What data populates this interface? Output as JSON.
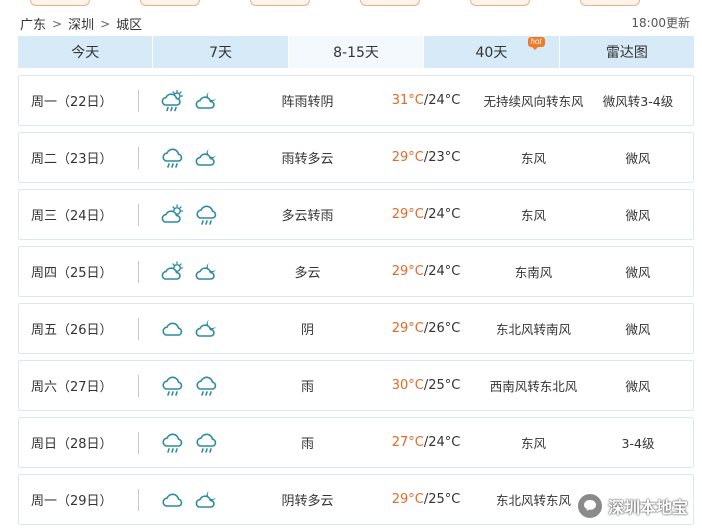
{
  "breadcrumb": {
    "province": "广东",
    "city": "深圳",
    "district": "城区"
  },
  "update_time": "18:00更新",
  "tabs": [
    {
      "label": "今天"
    },
    {
      "label": "7天"
    },
    {
      "label": "8-15天"
    },
    {
      "label": "40天",
      "badge": "hot"
    },
    {
      "label": "雷达图"
    }
  ],
  "active_tab": "8-15天",
  "forecast": [
    {
      "day": "周一（22日）",
      "icon_day": "rain-sun-icon",
      "icon_night": "cloud-moon-icon",
      "desc": "阵雨转阴",
      "high": "31°C",
      "low": "/24°C",
      "wind": "无持续风向转东风",
      "level": "微风转3-4级"
    },
    {
      "day": "周二（23日）",
      "icon_day": "rain-icon",
      "icon_night": "cloud-moon-icon",
      "desc": "雨转多云",
      "high": "29°C",
      "low": "/23°C",
      "wind": "东风",
      "level": "微风"
    },
    {
      "day": "周三（24日）",
      "icon_day": "partly-cloudy-icon",
      "icon_night": "rain-icon",
      "desc": "多云转雨",
      "high": "29°C",
      "low": "/24°C",
      "wind": "东风",
      "level": "微风"
    },
    {
      "day": "周四（25日）",
      "icon_day": "partly-cloudy-icon",
      "icon_night": "cloud-moon-icon",
      "desc": "多云",
      "high": "29°C",
      "low": "/24°C",
      "wind": "东南风",
      "level": "微风"
    },
    {
      "day": "周五（26日）",
      "icon_day": "cloud-icon",
      "icon_night": "cloud-moon-icon",
      "desc": "阴",
      "high": "29°C",
      "low": "/26°C",
      "wind": "东北风转南风",
      "level": "微风"
    },
    {
      "day": "周六（27日）",
      "icon_day": "rain-icon",
      "icon_night": "rain-icon",
      "desc": "雨",
      "high": "30°C",
      "low": "/25°C",
      "wind": "西南风转东北风",
      "level": "微风"
    },
    {
      "day": "周日（28日）",
      "icon_day": "rain-icon",
      "icon_night": "rain-icon",
      "desc": "雨",
      "high": "27°C",
      "low": "/24°C",
      "wind": "东风",
      "level": "3-4级"
    },
    {
      "day": "周一（29日）",
      "icon_day": "cloud-icon",
      "icon_night": "cloud-moon-icon",
      "desc": "阴转多云",
      "high": "29°C",
      "low": "/25°C",
      "wind": "东北风转东风",
      "level": ""
    }
  ],
  "watermark": "深圳本地宝",
  "colors": {
    "tab_bar": "#d7eaf8",
    "active_tab": "#f4f9fd",
    "high_temp": "#e06a2a",
    "icon_stroke": "#2e8aa0",
    "hot_badge": "#f07a28"
  }
}
